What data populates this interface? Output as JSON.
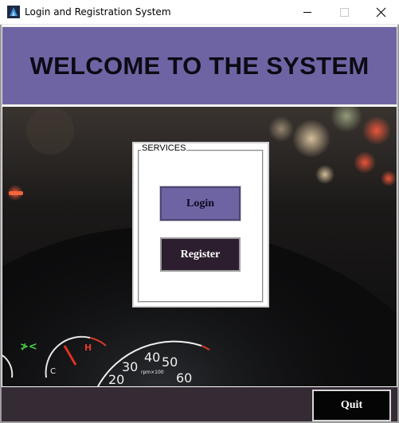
{
  "window": {
    "title": "Login and Registration System",
    "icons": {
      "app": "app-logo-icon",
      "minimize": "minimize-icon",
      "maximize": "maximize-icon",
      "close": "close-icon"
    }
  },
  "header": {
    "title": "WELCOME TO THE SYSTEM",
    "background_color": "#6f64a3"
  },
  "background": {
    "description_icon": "car-dashboard-photo"
  },
  "services": {
    "legend": "SERVICES",
    "login_label": "Login",
    "register_label": "Register",
    "login_color": "#6f64a3",
    "register_color": "#2c1e2e"
  },
  "footer": {
    "quit_label": "Quit",
    "background_color": "#352b35"
  }
}
